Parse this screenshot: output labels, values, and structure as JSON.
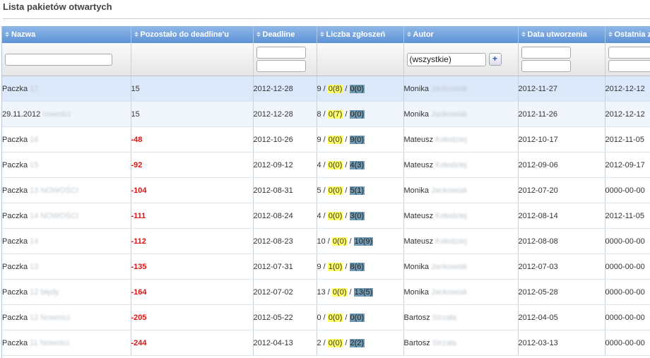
{
  "page": {
    "title": "Lista pakietów otwartych"
  },
  "table": {
    "columns": [
      "Nazwa",
      "Pozostało do deadline'u",
      "Deadline",
      "Liczba zgłoszeń",
      "Autor",
      "Data utworzenia",
      "Ostatnia zmiana"
    ],
    "filters": {
      "author_select": "(wszystkie)",
      "add_label": "+"
    },
    "rows": [
      {
        "name": "Paczka",
        "name_blur": "17",
        "remaining": "15",
        "deadline": "2012-12-28",
        "count_total": "9",
        "count_a": "0(8)",
        "count_b": "0(0)",
        "author_first": "Monika",
        "author_blur": "Jankowiak",
        "created": "2012-11-27",
        "last": "2012-12-12"
      },
      {
        "name": "29.11.2012",
        "name_blur": "nowości",
        "remaining": "15",
        "deadline": "2012-12-28",
        "count_total": "8",
        "count_a": "0(7)",
        "count_b": "0(0)",
        "author_first": "Monika",
        "author_blur": "Jankowiak",
        "created": "2012-11-26",
        "last": "2012-12-12"
      },
      {
        "name": "Paczka",
        "name_blur": "16",
        "remaining": "-48",
        "deadline": "2012-10-26",
        "count_total": "9",
        "count_a": "0(0)",
        "count_b": "9(0)",
        "author_first": "Mateusz",
        "author_blur": "Kołodziej",
        "created": "2012-10-17",
        "last": "2012-11-05"
      },
      {
        "name": "Paczka",
        "name_blur": "15",
        "remaining": "-92",
        "deadline": "2012-09-12",
        "count_total": "4",
        "count_a": "0(0)",
        "count_b": "4(3)",
        "author_first": "Mateusz",
        "author_blur": "Kołodziej",
        "created": "2012-09-06",
        "last": "2012-09-17"
      },
      {
        "name": "Paczka",
        "name_blur": "13 NOWOŚCI",
        "remaining": "-104",
        "deadline": "2012-08-31",
        "count_total": "5",
        "count_a": "0(0)",
        "count_b": "5(1)",
        "author_first": "Monika",
        "author_blur": "Jankowiak",
        "created": "2012-07-20",
        "last": "0000-00-00"
      },
      {
        "name": "Paczka",
        "name_blur": "14 NOWOŚCI",
        "remaining": "-111",
        "deadline": "2012-08-24",
        "count_total": "4",
        "count_a": "0(0)",
        "count_b": "3(0)",
        "author_first": "Mateusz",
        "author_blur": "Kołodziej",
        "created": "2012-08-14",
        "last": "2012-11-05"
      },
      {
        "name": "Paczka",
        "name_blur": "14",
        "remaining": "-112",
        "deadline": "2012-08-23",
        "count_total": "10",
        "count_a": "0(0)",
        "count_b": "10(9)",
        "author_first": "Mateusz",
        "author_blur": "Kołodziej",
        "created": "2012-08-08",
        "last": "0000-00-00"
      },
      {
        "name": "Paczka",
        "name_blur": "13",
        "remaining": "-135",
        "deadline": "2012-07-31",
        "count_total": "9",
        "count_a": "1(0)",
        "count_b": "8(6)",
        "author_first": "Monika",
        "author_blur": "Jankowiak",
        "created": "2012-07-03",
        "last": "0000-00-00"
      },
      {
        "name": "Paczka",
        "name_blur": "12 błędy",
        "remaining": "-164",
        "deadline": "2012-07-02",
        "count_total": "13",
        "count_a": "0(0)",
        "count_b": "13(5)",
        "author_first": "Monika",
        "author_blur": "Jankowiak",
        "created": "2012-05-28",
        "last": "0000-00-00"
      },
      {
        "name": "Paczka",
        "name_blur": "12 Nowości",
        "remaining": "-205",
        "deadline": "2012-05-22",
        "count_total": "0",
        "count_a": "0(0)",
        "count_b": "0(0)",
        "author_first": "Bartosz",
        "author_blur": "Strzała",
        "created": "2012-04-05",
        "last": "0000-00-00"
      },
      {
        "name": "Paczka",
        "name_blur": "11 Nowości",
        "remaining": "-244",
        "deadline": "2012-04-13",
        "count_total": "2",
        "count_a": "0(0)",
        "count_b": "2(2)",
        "author_first": "Bartosz",
        "author_blur": "Strzała",
        "created": "2012-03-13",
        "last": "0000-00-00"
      }
    ]
  },
  "colors": {
    "header_top": "#8fb8e8",
    "header_bottom": "#5d92d6",
    "negative": "#dd1111",
    "highlight_yellow": "#ffff66",
    "highlight_blue": "#6f9ab3"
  }
}
